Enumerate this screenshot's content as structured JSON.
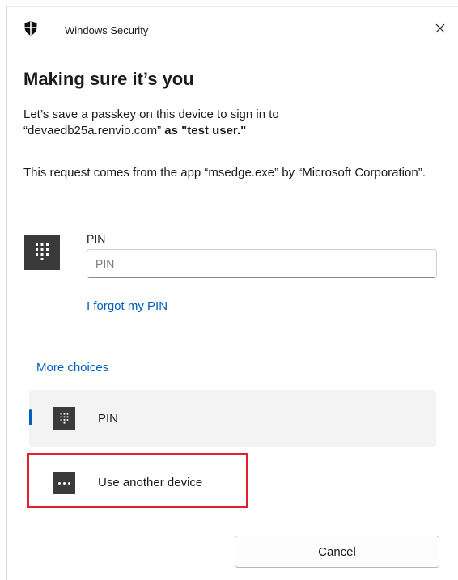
{
  "window": {
    "app_title": "Windows Security",
    "close_icon": "close-icon"
  },
  "heading": "Making sure it’s you",
  "message": {
    "line1": "Let’s save a passkey on this device to sign in to",
    "line2_domain": "“devaedb25a.renvio.com”",
    "line2_user": "as \"test user.\"",
    "request_line": "This request comes from the app “msedge.exe” by “Microsoft Corporation”."
  },
  "pin_section": {
    "icon": "keypad-icon",
    "label": "PIN",
    "input_value": "",
    "input_placeholder": "PIN",
    "forgot_link": "I forgot my PIN"
  },
  "more_choices": {
    "label": "More choices",
    "options": [
      {
        "label": "PIN",
        "icon": "keypad-icon",
        "selected": true
      },
      {
        "label": "Use another device",
        "icon": "more-dots-icon",
        "selected": false
      }
    ]
  },
  "actions": {
    "cancel_label": "Cancel"
  },
  "colors": {
    "accent": "#005fb8",
    "highlight_border": "#e0202e",
    "tile": "#3a3a3a",
    "selected_bg": "#f3f3f3"
  }
}
